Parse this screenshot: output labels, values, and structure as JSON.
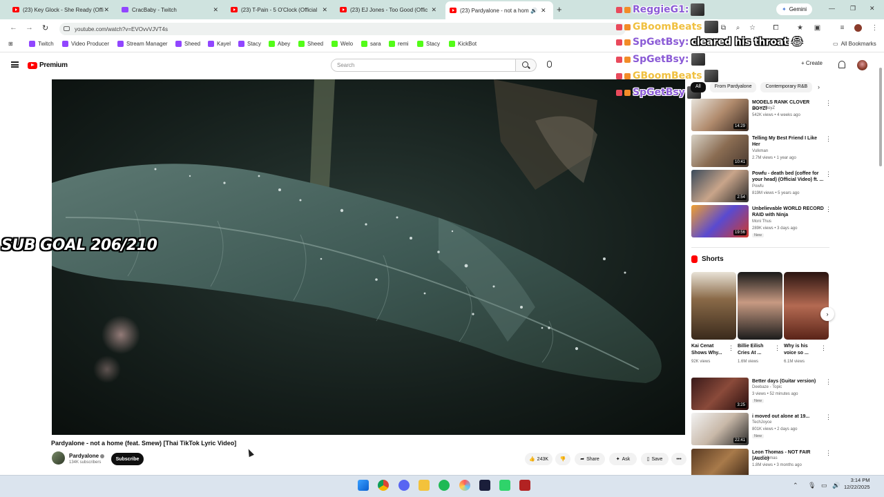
{
  "browser": {
    "tabs": [
      {
        "label": "(23) Key Glock - She Ready (Offi",
        "kind": "youtube"
      },
      {
        "label": "CracBaby - Twitch",
        "kind": "twitch"
      },
      {
        "label": "(23) T-Pain - 5 O'Clock (Official",
        "kind": "youtube"
      },
      {
        "label": "(23) EJ Jones - Too Good (Offic",
        "kind": "youtube"
      },
      {
        "label": "(23) Pardyalone - not a hom",
        "kind": "youtube",
        "active": true
      }
    ],
    "gemini_label": "Gemini",
    "url": "youtube.com/watch?v=EVOvvVJVT4s",
    "bookmarks": [
      {
        "label": "Twitch",
        "kind": "twitch"
      },
      {
        "label": "Video Producer",
        "kind": "twitch"
      },
      {
        "label": "Stream Manager",
        "kind": "twitch"
      },
      {
        "label": "Sheed",
        "kind": "twitch"
      },
      {
        "label": "Kayel",
        "kind": "twitch"
      },
      {
        "label": "Stacy",
        "kind": "twitch"
      },
      {
        "label": "Abey",
        "kind": "kick"
      },
      {
        "label": "Sheed",
        "kind": "kick"
      },
      {
        "label": "Welo",
        "kind": "kick"
      },
      {
        "label": "sara",
        "kind": "kick"
      },
      {
        "label": "remi",
        "kind": "kick"
      },
      {
        "label": "Stacy",
        "kind": "kick"
      },
      {
        "label": "KickBot",
        "kind": "kick"
      }
    ],
    "all_bookmarks_label": "All Bookmarks"
  },
  "youtube": {
    "logo_text": "Premium",
    "search_placeholder": "Search",
    "create_label": "Create",
    "video_title": "Pardyalone - not a home (feat. Smew) [Thai TikTok Lyric Video]",
    "channel_name": "Pardyalone",
    "channel_subs": "134K subscribers",
    "subscribe_label": "Subscribe",
    "likes": "243K",
    "share_label": "Share",
    "ask_label": "Ask",
    "save_label": "Save",
    "chips": [
      "All",
      "From Pardyalone",
      "Contemporary R&B"
    ],
    "recommendations": [
      {
        "title": "MODELS RANK CLOVER BOYZ!",
        "channel": "Clover BoyZ",
        "meta": "542K views • 4 weeks ago",
        "duration": "14:29",
        "badge": ""
      },
      {
        "title": "Telling My Best Friend I Like Her",
        "channel": "Vulkman",
        "meta": "2.7M views • 1 year ago",
        "duration": "10:41",
        "badge": ""
      },
      {
        "title": "Powfu - death bed (coffee for your head) (Official Video) ft. ...",
        "channel": "Powfu",
        "meta": "819M views • 5 years ago",
        "duration": "2:54",
        "badge": ""
      },
      {
        "title": "Unbelievable WORLD RECORD RAID with Ninja",
        "channel": "Moni Thus",
        "meta": "289K views • 3 days ago",
        "duration": "19:56",
        "badge": "New"
      }
    ],
    "shorts_label": "Shorts",
    "shorts": [
      {
        "title": "Kai Cenat Shows Why...",
        "views": "92K views"
      },
      {
        "title": "Billie Eilish Cries At ...",
        "views": "1.6M views"
      },
      {
        "title": "Why is his voice so ...",
        "views": "6.1M views"
      }
    ],
    "recommendations2": [
      {
        "title": "Better days (Guitar version)",
        "channel": "Deebaze - Topic",
        "meta": "3 views • 52 minutes ago",
        "duration": "3:25",
        "badge": "New"
      },
      {
        "title": "i moved out alone at 19...",
        "channel": "TechJoyce",
        "meta": "801K views • 2 days ago",
        "duration": "22:41",
        "badge": "New"
      },
      {
        "title": "Leon Thomas - NOT FAIR (Audio)",
        "channel": "Leon Thomas",
        "meta": "1.8M views • 3 months ago",
        "duration": "",
        "badge": ""
      }
    ]
  },
  "overlay": {
    "sub_goal": "SUB GOAL 206/210",
    "chat": [
      {
        "user": "ReggieG1:",
        "message": "",
        "color": "#8b5bd6"
      },
      {
        "user": "GBoomBeats",
        "message": "",
        "color": "#f0c040"
      },
      {
        "user": "SpGetBsy:",
        "message": "cleared his throat 😂",
        "color": "#8b5bd6"
      },
      {
        "user": "SpGetBsy:",
        "message": "",
        "color": "#8b5bd6"
      },
      {
        "user": "GBoomBeats",
        "message": "",
        "color": "#f0c040"
      },
      {
        "user": "SpGetBsy",
        "message": "",
        "color": "#8b5bd6"
      }
    ]
  },
  "taskbar": {
    "time": "3:14 PM",
    "date": "12/22/2025"
  }
}
